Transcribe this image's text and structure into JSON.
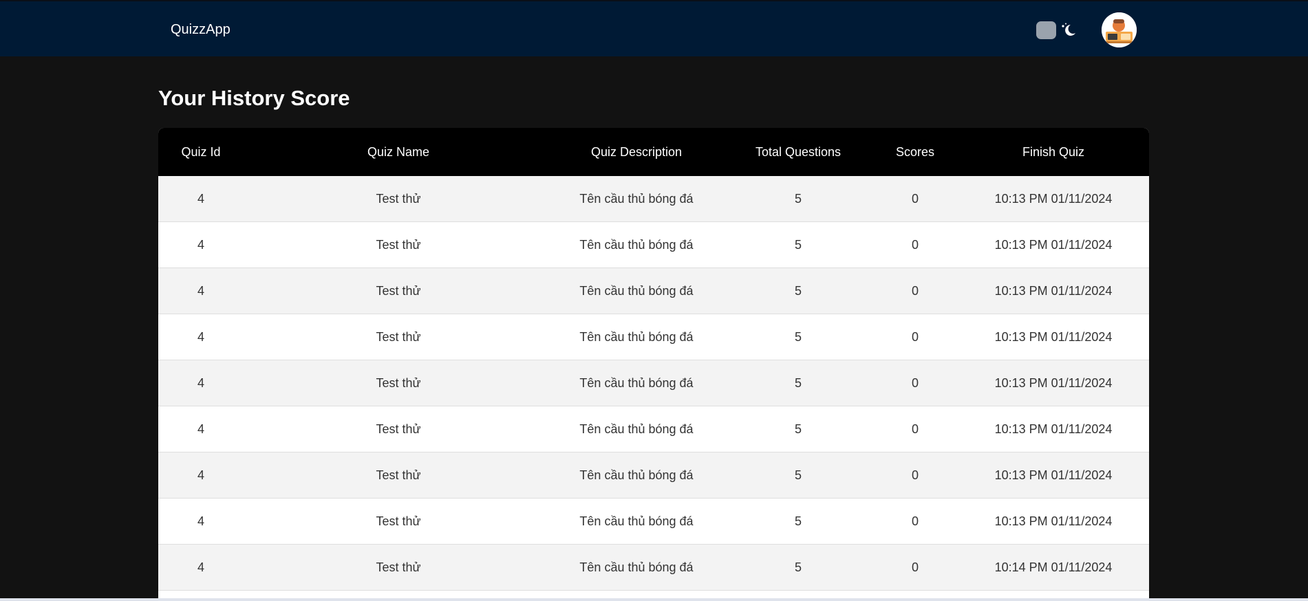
{
  "header": {
    "brand": "QuizzApp",
    "theme_toggle_icon": "moon-icon",
    "avatar_icon": "user-avatar"
  },
  "main": {
    "title": "Your History Score"
  },
  "table": {
    "columns": [
      "Quiz Id",
      "Quiz Name",
      "Quiz Description",
      "Total Questions",
      "Scores",
      "Finish Quiz"
    ],
    "rows": [
      [
        "4",
        "Test thử",
        "Tên cầu thủ bóng đá",
        "5",
        "0",
        "10:13 PM 01/11/2024"
      ],
      [
        "4",
        "Test thử",
        "Tên cầu thủ bóng đá",
        "5",
        "0",
        "10:13 PM 01/11/2024"
      ],
      [
        "4",
        "Test thử",
        "Tên cầu thủ bóng đá",
        "5",
        "0",
        "10:13 PM 01/11/2024"
      ],
      [
        "4",
        "Test thử",
        "Tên cầu thủ bóng đá",
        "5",
        "0",
        "10:13 PM 01/11/2024"
      ],
      [
        "4",
        "Test thử",
        "Tên cầu thủ bóng đá",
        "5",
        "0",
        "10:13 PM 01/11/2024"
      ],
      [
        "4",
        "Test thử",
        "Tên cầu thủ bóng đá",
        "5",
        "0",
        "10:13 PM 01/11/2024"
      ],
      [
        "4",
        "Test thử",
        "Tên cầu thủ bóng đá",
        "5",
        "0",
        "10:13 PM 01/11/2024"
      ],
      [
        "4",
        "Test thử",
        "Tên cầu thủ bóng đá",
        "5",
        "0",
        "10:13 PM 01/11/2024"
      ],
      [
        "4",
        "Test thử",
        "Tên cầu thủ bóng đá",
        "5",
        "0",
        "10:14 PM 01/11/2024"
      ]
    ]
  },
  "colors": {
    "navbar": "#001a35",
    "page_background": "#121212",
    "table_header": "#000000",
    "row_alt": "#f3f3f3"
  }
}
